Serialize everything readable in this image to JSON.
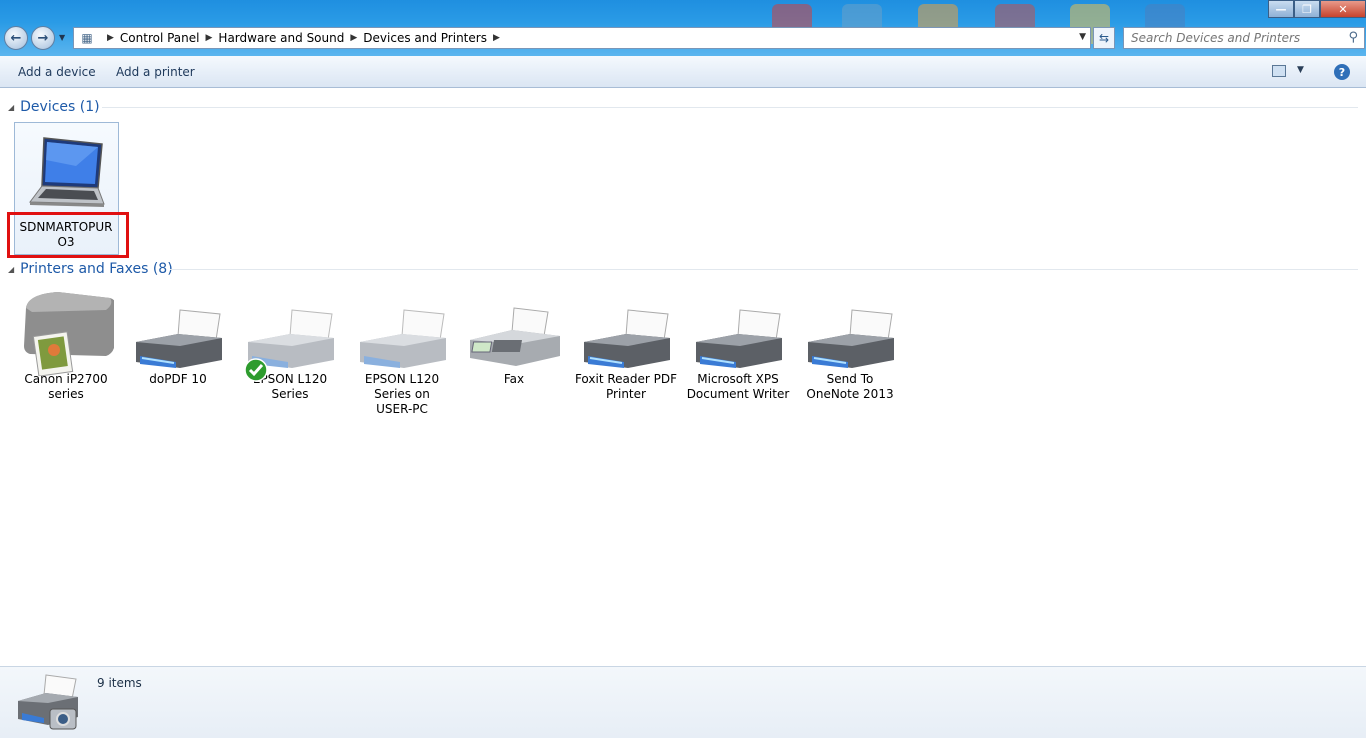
{
  "address": {
    "crumbs": [
      "Control Panel",
      "Hardware and Sound",
      "Devices and Printers"
    ]
  },
  "search": {
    "placeholder": "Search Devices and Printers"
  },
  "toolbar": {
    "add_device": "Add a device",
    "add_printer": "Add a printer",
    "help": "?"
  },
  "groups": {
    "devices": {
      "title": "Devices (1)"
    },
    "printers": {
      "title": "Printers and Faxes (8)"
    }
  },
  "devices": [
    {
      "line1": "SDNMARTOPUR",
      "line2": "O3"
    }
  ],
  "printers": [
    {
      "line1": "Canon iP2700",
      "line2": "series",
      "line3": ""
    },
    {
      "line1": "doPDF 10",
      "line2": "",
      "line3": ""
    },
    {
      "line1": "EPSON L120",
      "line2": "Series",
      "line3": ""
    },
    {
      "line1": "EPSON L120",
      "line2": "Series on",
      "line3": "USER-PC"
    },
    {
      "line1": "Fax",
      "line2": "",
      "line3": ""
    },
    {
      "line1": "Foxit Reader PDF",
      "line2": "Printer",
      "line3": ""
    },
    {
      "line1": "Microsoft XPS",
      "line2": "Document Writer",
      "line3": ""
    },
    {
      "line1": "Send To",
      "line2": "OneNote 2013",
      "line3": ""
    }
  ],
  "status": {
    "text": "9 items"
  },
  "colors": {
    "accent": "#1e5aa8",
    "highlight": "#e01010"
  }
}
